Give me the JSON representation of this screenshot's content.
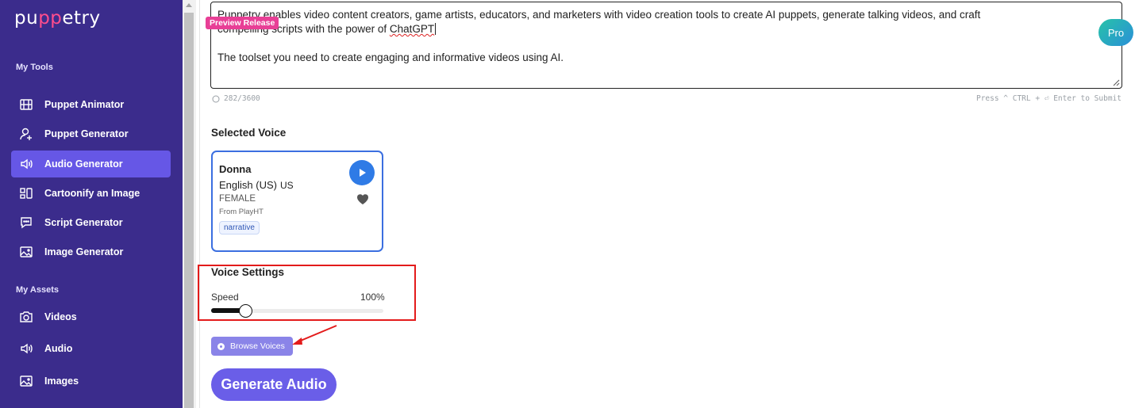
{
  "sidebar": {
    "logo": {
      "before": "pu",
      "highlight": "pp",
      "after": "etry"
    },
    "sections": {
      "tools_title": "My Tools",
      "assets_title": "My Assets"
    },
    "tools": [
      {
        "label": "Puppet Animator",
        "icon": "film-icon"
      },
      {
        "label": "Puppet Generator",
        "icon": "user-plus-icon"
      },
      {
        "label": "Audio Generator",
        "icon": "speaker-icon",
        "active": true
      },
      {
        "label": "Cartoonify an Image",
        "icon": "layout-icon"
      },
      {
        "label": "Script Generator",
        "icon": "chat-icon"
      },
      {
        "label": "Image Generator",
        "icon": "image-icon"
      }
    ],
    "assets": [
      {
        "label": "Videos",
        "icon": "camera-icon"
      },
      {
        "label": "Audio",
        "icon": "speaker-icon"
      },
      {
        "label": "Images",
        "icon": "image-icon"
      }
    ]
  },
  "editor": {
    "line1": "Puppetry enables video content creators, game artists, educators, and marketers with video creation tools to create AI puppets, generate talking videos, and craft",
    "line2_prefix": "compelling scripts with the power of ",
    "line2_misspelled": "ChatGPT",
    "line3": "The toolset you need to create engaging and informative videos using AI.",
    "counter": "282/3600",
    "hint": "Press ^ CTRL + ⏎ Enter to Submit",
    "preview_badge": "Preview Release",
    "pro_badge": "Pro"
  },
  "selected_voice": {
    "heading": "Selected Voice",
    "name": "Donna",
    "language": "English (US)",
    "country_code": "US",
    "gender": "FEMALE",
    "source": "From PlayHT",
    "tag": "narrative"
  },
  "voice_settings": {
    "heading": "Voice Settings",
    "speed_label": "Speed",
    "speed_value": "100%",
    "speed_fraction": 0.2
  },
  "actions": {
    "browse_voices": "Browse Voices",
    "generate_audio": "Generate Audio"
  },
  "colors": {
    "sidebar_bg": "#3b2c8c",
    "active_item": "#6657e6",
    "primary": "#6a5ee8",
    "annotation_red": "#e31b1b"
  }
}
